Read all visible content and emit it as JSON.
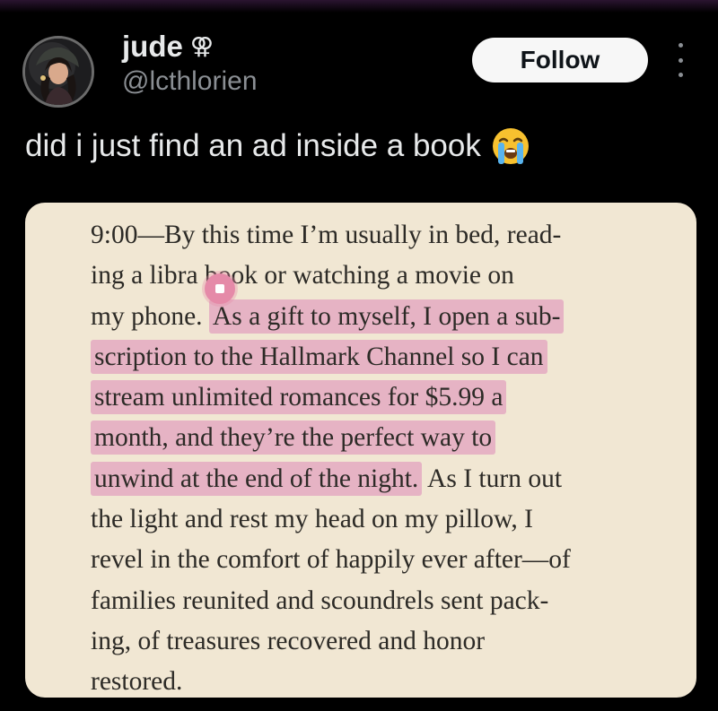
{
  "user": {
    "display_name": "jude",
    "gender_symbol": "⚢",
    "handle": "@lcthlorien",
    "avatar": "profile-photo"
  },
  "actions": {
    "follow_label": "Follow",
    "more_icon": "more-vertical-icon"
  },
  "post": {
    "text": "did i just find an ad inside a book",
    "emoji": "loudly-crying-face"
  },
  "book": {
    "lines": [
      {
        "plain": "9:00—By this time I’m usually in bed, read-",
        "highlight": "",
        "after": ""
      },
      {
        "plain": "ing a libra    book or watching a movie on",
        "highlight": "",
        "after": ""
      },
      {
        "plain": "my phone. ",
        "highlight": "As a gift to myself, I open a sub-",
        "after": ""
      },
      {
        "plain": "",
        "highlight": "scription to the Hallmark Channel so I can",
        "after": ""
      },
      {
        "plain": "",
        "highlight": "stream unlimited romances for $5.99 a",
        "after": ""
      },
      {
        "plain": "",
        "highlight": "month, and they’re the perfect way to",
        "after": ""
      },
      {
        "plain": "",
        "highlight": "unwind at the end of the night.",
        "after": " As I turn out"
      },
      {
        "plain": "the light and rest my head on my pillow, I",
        "highlight": "",
        "after": ""
      },
      {
        "plain": "revel in the comfort of happily ever after—of",
        "highlight": "",
        "after": ""
      },
      {
        "plain": "families reunited and scoundrels sent pack-",
        "highlight": "",
        "after": ""
      },
      {
        "plain": "ing, of treasures recovered and honor",
        "highlight": "",
        "after": ""
      },
      {
        "plain": "restored.",
        "highlight": "",
        "after": ""
      }
    ],
    "highlight_color": "#e6b3c4",
    "page_color": "#f1e7d3"
  },
  "colors": {
    "background": "#000000",
    "text_primary": "#e7e9ea",
    "text_secondary": "#8b8f94",
    "follow_bg": "#f7f7f7"
  }
}
